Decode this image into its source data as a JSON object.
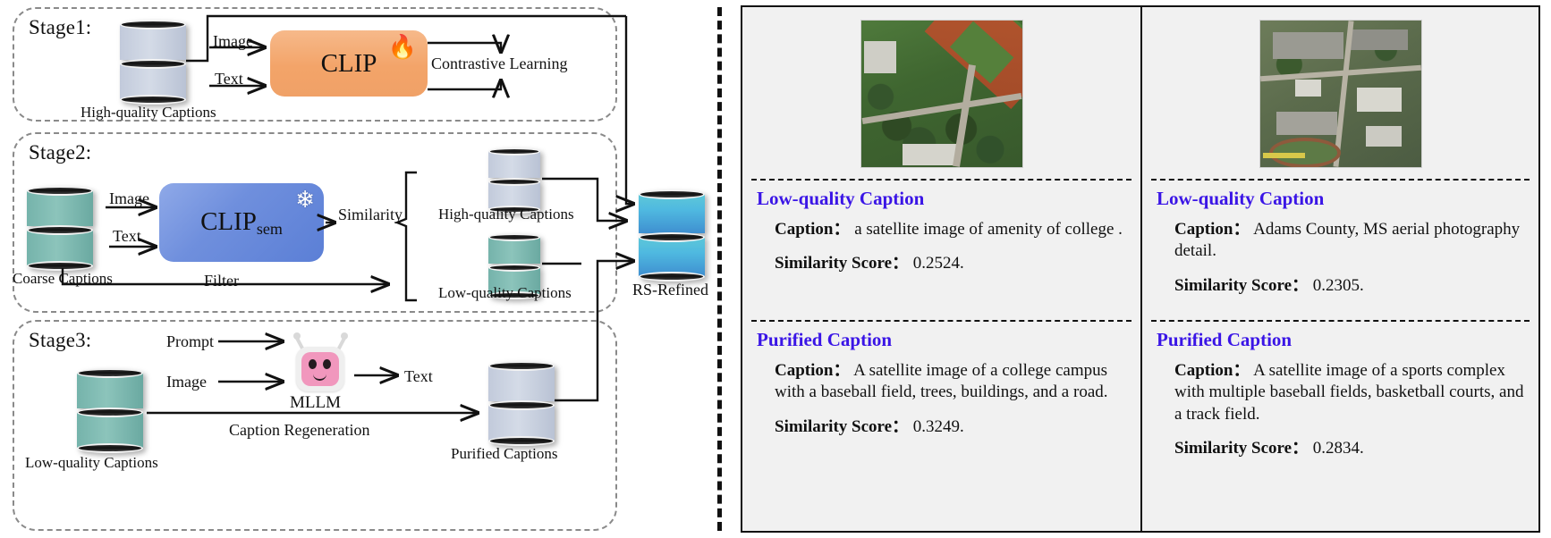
{
  "figure": {
    "left_pipeline": {
      "stages": [
        {
          "id": "stage1",
          "label": "Stage1:",
          "db_caption": "High-quality Captions",
          "model": "CLIP",
          "model_sub": "",
          "model_state_icon": "flame-icon",
          "input_labels": [
            "Image",
            "Text"
          ],
          "output_label": "Contrastive Learning"
        },
        {
          "id": "stage2",
          "label": "Stage2:",
          "db_caption": "Coarse  Captions",
          "model": "CLIP",
          "model_sub": "sem",
          "model_state_icon": "snowflake-icon",
          "input_labels": [
            "Image",
            "Text"
          ],
          "output_label": "Similarity",
          "filter_label": "Filter",
          "branch_high": "High-quality  Captions",
          "branch_low": "Low-quality  Captions"
        },
        {
          "id": "stage3",
          "label": "Stage3:",
          "db_caption": "Low-quality  Captions",
          "model": "MLLM",
          "model_state_icon": "robot-icon",
          "input_labels": [
            "Prompt",
            "Image"
          ],
          "output_label": "Text",
          "process_label": "Caption Regeneration",
          "result_caption": "Purified Captions"
        }
      ],
      "output_db_caption": "RS-Refined"
    },
    "examples_panel": {
      "columns": [
        {
          "image_alt": "satellite-image-college-campus",
          "sections": [
            {
              "heading": "Low-quality Caption",
              "caption_label": "Caption：",
              "caption_text": "a satellite image of amenity of college .",
              "score_label": "Similarity Score：",
              "score_value": "0.2524."
            },
            {
              "heading": "Purified Caption",
              "caption_label": "Caption：",
              "caption_text": "A satellite image of a college campus with a baseball field, trees, buildings, and a road.",
              "score_label": "Similarity Score：",
              "score_value": "0.3249."
            }
          ]
        },
        {
          "image_alt": "satellite-image-sports-complex",
          "sections": [
            {
              "heading": "Low-quality Caption",
              "caption_label": "Caption：",
              "caption_text": "Adams County, MS aerial photography detail.",
              "score_label": "Similarity Score：",
              "score_value": "0.2305."
            },
            {
              "heading": "Purified Caption",
              "caption_label": "Caption：",
              "caption_text": "A satellite image of a sports complex with multiple baseball fields, basketball courts, and a track field.",
              "score_label": "Similarity Score：",
              "score_value": "0.2834."
            }
          ]
        }
      ]
    },
    "colors": {
      "heading_blue": "#3a15e6",
      "clip_orange": "#f3a469",
      "clipsem_blue": "#6f8fdd",
      "db_blue": "#c6cedd",
      "db_teal": "#7cb8b0",
      "db_cyan": "#4fb9e0",
      "robot_pink": "#f197bd"
    }
  }
}
